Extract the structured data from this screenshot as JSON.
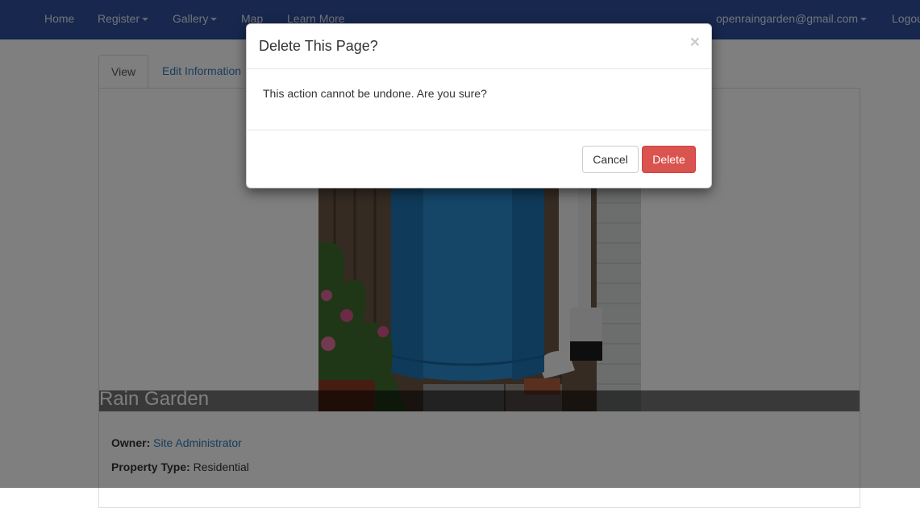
{
  "navbar": {
    "items": [
      {
        "label": "Home"
      },
      {
        "label": "Register"
      },
      {
        "label": "Gallery"
      },
      {
        "label": "Map"
      },
      {
        "label": "Learn More"
      }
    ],
    "account": "openraingarden@gmail.com",
    "logout": "Logout"
  },
  "tabs": [
    {
      "label": "View"
    },
    {
      "label": "Edit Information"
    }
  ],
  "garden": {
    "title": "Rain Garden",
    "owner_label": "Owner:",
    "owner_value": "Site Administrator",
    "property_label": "Property Type:",
    "property_value": "Residential"
  },
  "modal": {
    "title": "Delete This Page?",
    "close": "×",
    "body": "This action cannot be undone. Are you sure?",
    "cancel": "Cancel",
    "delete": "Delete"
  },
  "colors": {
    "navbar": "#2f4e9c",
    "link": "#337ab7",
    "danger": "#d9534f"
  }
}
